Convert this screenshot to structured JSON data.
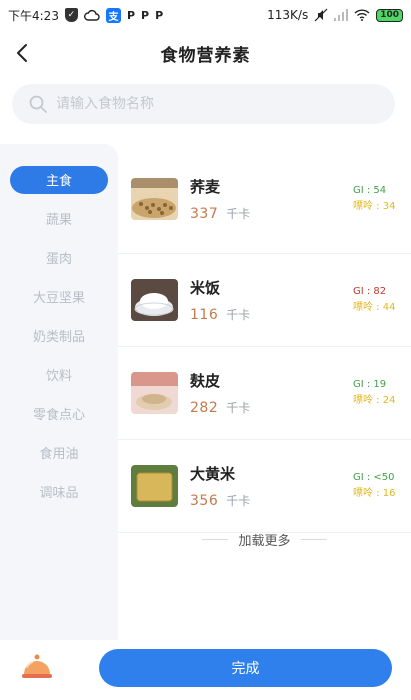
{
  "status_bar": {
    "time": "下午4:23",
    "network_speed": "113K/s",
    "battery": "100",
    "app_icons": [
      "shield-icon",
      "cloud-icon",
      "alipay-icon",
      "parking-p-icon",
      "parking-p-icon",
      "parking-p-icon"
    ]
  },
  "header": {
    "title": "食物营养素"
  },
  "search": {
    "placeholder": "请输入食物名称"
  },
  "sidebar": {
    "items": [
      {
        "label": "主食",
        "active": true
      },
      {
        "label": "蔬果",
        "active": false
      },
      {
        "label": "蛋肉",
        "active": false
      },
      {
        "label": "大豆坚果",
        "active": false
      },
      {
        "label": "奶类制品",
        "active": false
      },
      {
        "label": "饮料",
        "active": false
      },
      {
        "label": "零食点心",
        "active": false
      },
      {
        "label": "食用油",
        "active": false
      },
      {
        "label": "调味品",
        "active": false
      }
    ]
  },
  "foods": [
    {
      "name": "荞麦",
      "calories": "337",
      "unit": "千卡",
      "gi": "GI : 54",
      "gl": "嘌呤 : 34",
      "gi_color": "#43a047"
    },
    {
      "name": "米饭",
      "calories": "116",
      "unit": "千卡",
      "gi": "GI : 82",
      "gl": "嘌呤 : 44",
      "gi_color": "#c0392b"
    },
    {
      "name": "麸皮",
      "calories": "282",
      "unit": "千卡",
      "gi": "GI : 19",
      "gl": "嘌呤 : 24",
      "gi_color": "#43a047"
    },
    {
      "name": "大黄米",
      "calories": "356",
      "unit": "千卡",
      "gi": "GI : <50",
      "gl": "嘌呤 : 16",
      "gi_color": "#43a047"
    }
  ],
  "load_more": "加载更多",
  "bottom": {
    "done_label": "完成"
  },
  "colors": {
    "accent": "#2f80ed",
    "calorie": "#c47a4f",
    "gi_good": "#43a047",
    "gi_bad": "#c0392b",
    "purine": "#e0b81e"
  }
}
